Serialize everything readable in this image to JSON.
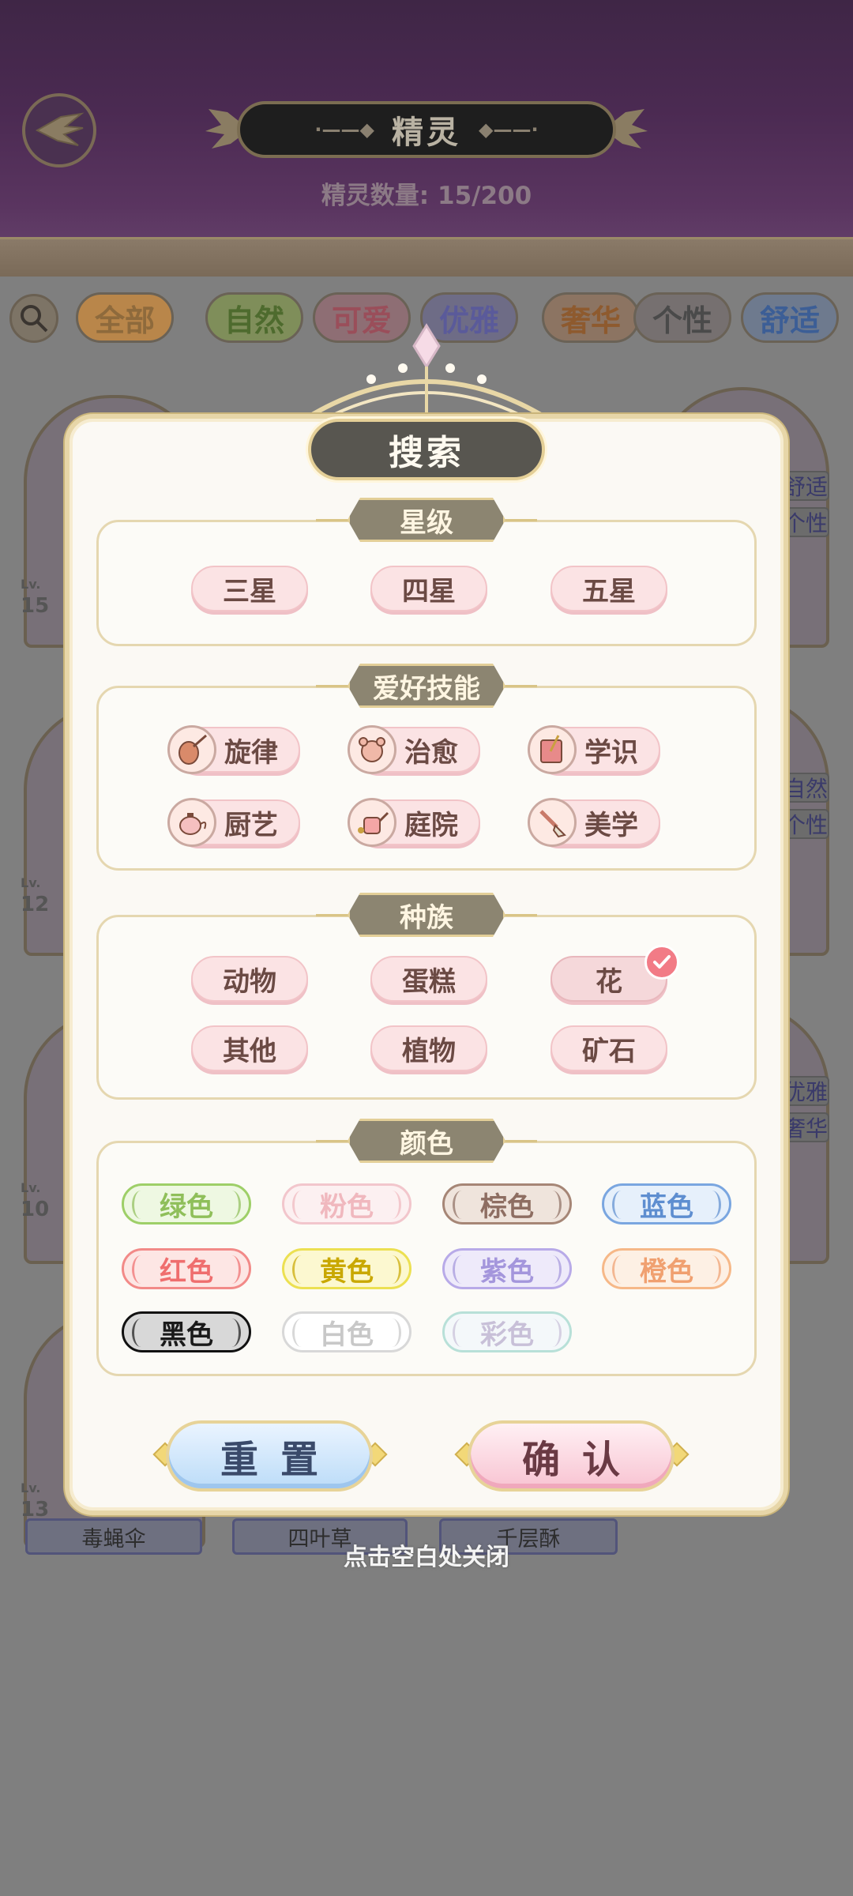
{
  "header": {
    "title": "精灵",
    "count_label": "精灵数量: 15/200"
  },
  "filter_tabs": [
    {
      "label": "全部",
      "color": "#8e6a3c",
      "bg": "#b9864a"
    },
    {
      "label": "自然",
      "color": "#4e6b2e",
      "bg": "#7f8e5a"
    },
    {
      "label": "可爱",
      "color": "#9a4e5a",
      "bg": "#8e6e74"
    },
    {
      "label": "优雅",
      "color": "#5a5a9a",
      "bg": "#6e6c86"
    },
    {
      "label": "奢华",
      "color": "#8e5a2e",
      "bg": "#8c7462"
    },
    {
      "label": "个性",
      "color": "#4a4a4a",
      "bg": "#767070"
    },
    {
      "label": "舒适",
      "color": "#3c5e96",
      "bg": "#6e7a8e"
    }
  ],
  "background_cards": {
    "names": [
      "毒蝇伞",
      "四叶草",
      "千层酥"
    ],
    "levels": [
      "15",
      "12",
      "10",
      "13"
    ],
    "lv_prefix": "Lv.",
    "side_tags": [
      "舒适",
      "个性",
      "自然",
      "个性",
      "优雅",
      "奢华"
    ]
  },
  "modal": {
    "title": "搜索",
    "sections": {
      "star": {
        "title": "星级",
        "options": [
          "三星",
          "四星",
          "五星"
        ]
      },
      "hobby": {
        "title": "爱好技能",
        "options": [
          {
            "label": "旋律",
            "icon": "violin-icon"
          },
          {
            "label": "治愈",
            "icon": "bear-icon"
          },
          {
            "label": "学识",
            "icon": "book-icon"
          },
          {
            "label": "厨艺",
            "icon": "teapot-icon"
          },
          {
            "label": "庭院",
            "icon": "watering-can-icon"
          },
          {
            "label": "美学",
            "icon": "paintbrush-icon"
          }
        ]
      },
      "race": {
        "title": "种族",
        "options": [
          "动物",
          "蛋糕",
          "花",
          "其他",
          "植物",
          "矿石"
        ],
        "selected": "花"
      },
      "color": {
        "title": "颜色",
        "options": [
          {
            "label": "绿色",
            "text": "#8fbf5a",
            "border": "#9ecf68",
            "bg": "#eef8e2"
          },
          {
            "label": "粉色",
            "text": "#f0b8be",
            "border": "#f2c6cc",
            "bg": "#fcf0f1"
          },
          {
            "label": "棕色",
            "text": "#8e6e62",
            "border": "#a68676",
            "bg": "#efe4dc"
          },
          {
            "label": "蓝色",
            "text": "#5e8ed0",
            "border": "#7aa6e0",
            "bg": "#e6f0fb"
          },
          {
            "label": "红色",
            "text": "#ef6e6e",
            "border": "#f28a88",
            "bg": "#fde6e4"
          },
          {
            "label": "黄色",
            "text": "#c9a800",
            "border": "#ece052",
            "bg": "#fcf8d0"
          },
          {
            "label": "紫色",
            "text": "#a496dc",
            "border": "#b8aae8",
            "bg": "#eeeafa"
          },
          {
            "label": "橙色",
            "text": "#f0a070",
            "border": "#f6b888",
            "bg": "#fdf0e4"
          },
          {
            "label": "黑色",
            "text": "#1a1a1a",
            "border": "#111111",
            "bg": "#d8d8d8"
          },
          {
            "label": "白色",
            "text": "#c8c8c8",
            "border": "#d8d8d8",
            "bg": "#ffffff"
          },
          {
            "label": "彩色",
            "text": "#c8c0d8",
            "border": "#b8e0d8",
            "bg": "#f4f8fa"
          }
        ]
      }
    },
    "buttons": {
      "reset": "重置",
      "confirm": "确认"
    }
  },
  "close_hint": "点击空白处关闭"
}
